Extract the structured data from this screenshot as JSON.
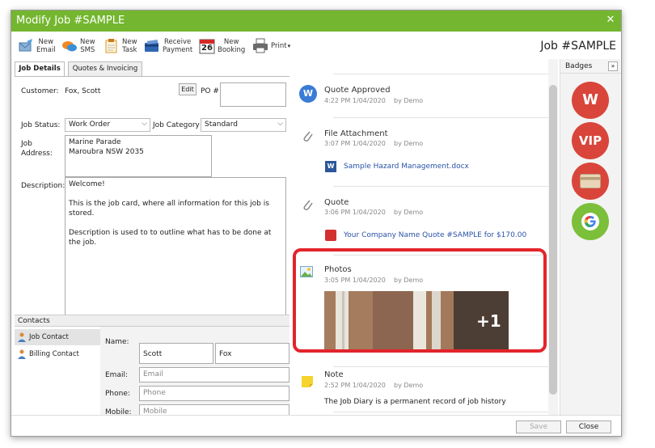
{
  "window": {
    "title": "Modify Job #SAMPLE",
    "close_glyph": "✕"
  },
  "toolbar": {
    "new_email": "New\nEmail",
    "new_sms": "New\nSMS",
    "new_task": "New\nTask",
    "receive_payment": "Receive\nPayment",
    "calendar_day": "26",
    "new_booking": "New\nBooking",
    "print": "Print"
  },
  "job_title": "Job #SAMPLE",
  "tabs": [
    "Job Details",
    "Quotes & Invoicing"
  ],
  "job_details": {
    "customer_label": "Customer:",
    "customer_value": "Fox, Scott",
    "edit_label": "Edit",
    "po_label": "PO #",
    "job_status_label": "Job Status:",
    "job_status_value": "Work Order",
    "job_category_label": "Job Category",
    "job_category_value": "Standard",
    "job_address_label": "Job\nAddress:",
    "job_address_value": "Marine Parade\nMaroubra NSW 2035",
    "description_label": "Description:",
    "description_value": "Welcome!\n\nThis is the job card, where all information for this job is stored.\n\nDescription is used to to outline what has to be done at the job."
  },
  "contacts": {
    "header": "Contacts",
    "items": [
      "Job Contact",
      "Billing Contact"
    ],
    "name_label": "Name:",
    "first_name": "Scott",
    "last_name": "Fox",
    "email_label": "Email:",
    "email_placeholder": "Email",
    "phone_label": "Phone:",
    "phone_placeholder": "Phone",
    "mobile_label": "Mobile:",
    "mobile_placeholder": "Mobile"
  },
  "diary": [
    {
      "title": "Quote Approved",
      "time": "4:22 PM 1/04/2020",
      "by": "by Demo"
    },
    {
      "title": "File Attachment",
      "time": "3:07 PM 1/04/2020",
      "by": "by Demo",
      "link": "Sample Hazard Management.docx"
    },
    {
      "title": "Quote",
      "time": "3:06 PM 1/04/2020",
      "by": "by Demo",
      "link": "Your Company Name Quote #SAMPLE for $170.00"
    },
    {
      "title": "Photos",
      "time": "3:05 PM 1/04/2020",
      "by": "by Demo",
      "extra": "+1"
    },
    {
      "title": "Note",
      "time": "2:52 PM 1/04/2020",
      "by": "by Demo",
      "text": "The Job Diary is a permanent record of job history"
    }
  ],
  "badges": {
    "header": "Badges",
    "expand": "»",
    "items": [
      "W",
      "VIP"
    ]
  },
  "footer": {
    "save": "Save",
    "close": "Close"
  },
  "colors": {
    "titlebar": "#74b62f",
    "highlight": "#e3242b",
    "badge_red": "#d9453a",
    "badge_green": "#7cbf3a",
    "link": "#2a52a8"
  }
}
